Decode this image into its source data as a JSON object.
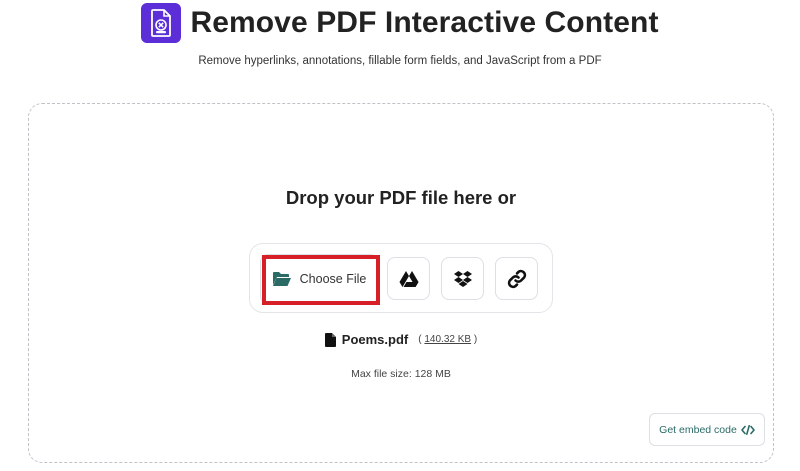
{
  "header": {
    "title": "Remove PDF Interactive Content",
    "subtitle": "Remove hyperlinks, annotations, fillable form fields, and JavaScript from a PDF",
    "logo_icon": "pdf-file-icon",
    "brand_color": "#5b2ed8"
  },
  "dropzone": {
    "heading": "Drop your PDF file here or",
    "choose_file_label": "Choose File",
    "choose_file_icon": "folder-open-icon",
    "sources": [
      {
        "name": "google-drive",
        "icon": "google-drive-icon"
      },
      {
        "name": "dropbox",
        "icon": "dropbox-icon"
      },
      {
        "name": "url",
        "icon": "link-icon"
      }
    ],
    "accent_color": "#2a6b66",
    "highlight_color": "#d61f26"
  },
  "file": {
    "name": "Poems.pdf",
    "size_open": "(",
    "size": "140.32 KB",
    "size_close": ")"
  },
  "limits": {
    "max_size_text": "Max file size: 128 MB"
  },
  "embed": {
    "label": "Get embed code",
    "icon": "code-icon"
  }
}
